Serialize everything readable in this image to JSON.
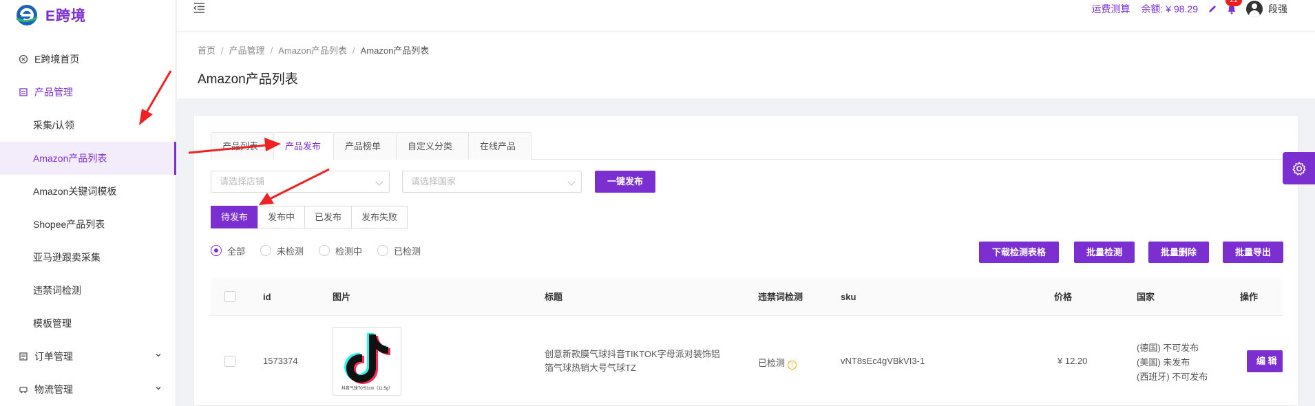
{
  "app": {
    "name": "E跨境",
    "brand_color": "#7b2fd0"
  },
  "sidebar": {
    "items": [
      {
        "label": "E跨境首页",
        "icon": "home-icon"
      },
      {
        "label": "产品管理",
        "icon": "product-icon"
      },
      {
        "label": "采集/认领"
      },
      {
        "label": "Amazon产品列表"
      },
      {
        "label": "Amazon关键词模板"
      },
      {
        "label": "Shopee产品列表"
      },
      {
        "label": "亚马逊跟卖采集"
      },
      {
        "label": "违禁词检测"
      },
      {
        "label": "模板管理"
      },
      {
        "label": "订单管理",
        "icon": "order-icon"
      },
      {
        "label": "物流管理",
        "icon": "truck-icon"
      }
    ]
  },
  "header": {
    "freight_calc": "运费测算",
    "balance": "余额: ¥ 98.29",
    "notifications": "21",
    "username": "段强"
  },
  "breadcrumb": [
    "首页",
    "产品管理",
    "Amazon产品列表",
    "Amazon产品列表"
  ],
  "page_title": "Amazon产品列表",
  "tabs": [
    "产品列表",
    "产品发布",
    "产品榜单",
    "自定义分类",
    "在线产品"
  ],
  "filters": {
    "store_placeholder": "请选择店铺",
    "country_placeholder": "请选择国家",
    "publish_all": "一键发布"
  },
  "status_tabs": [
    "待发布",
    "发布中",
    "已发布",
    "发布失败"
  ],
  "radios": [
    "全部",
    "未检测",
    "检测中",
    "已检测"
  ],
  "actions": {
    "download": "下载检测表格",
    "batch_check": "批量检测",
    "batch_delete": "批量删除",
    "batch_export": "批量导出"
  },
  "table": {
    "columns": [
      "id",
      "图片",
      "标题",
      "违禁词检测",
      "sku",
      "价格",
      "国家",
      "操作"
    ],
    "rows": [
      {
        "id": "1573374",
        "image_caption": "抖音气球70*51cm（11.5g）",
        "title_line1": "创意新款膜气球抖音TIKTOK字母派对装饰铝",
        "title_line2": "箔气球热销大号气球TZ",
        "detection": "已检测",
        "sku": "vNT8sEc4gVBkVI3-1",
        "price": "¥ 12.20",
        "country_1": "(德国) 不可发布",
        "country_2": "(美国) 未发布",
        "country_3": "(西班牙) 不可发布",
        "action": "编 辑"
      }
    ]
  }
}
